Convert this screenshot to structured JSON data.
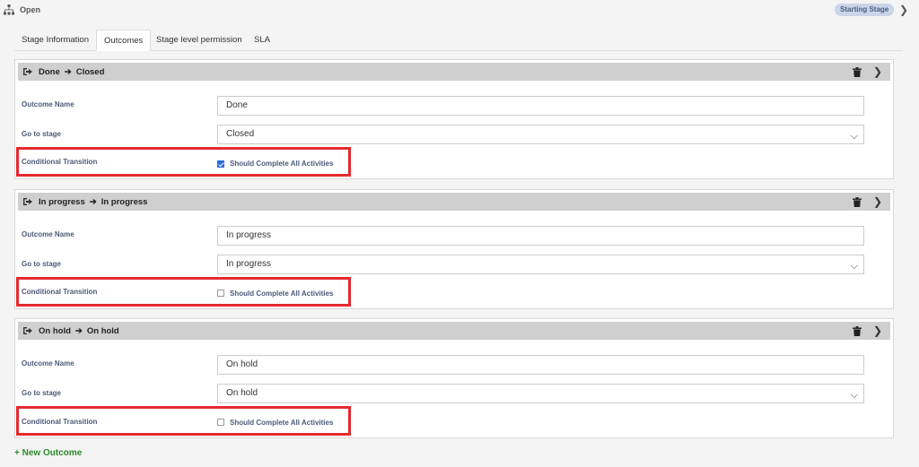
{
  "stage": {
    "name": "Open",
    "badge": "Starting Stage"
  },
  "tabs": [
    "Stage Information",
    "Outcomes",
    "Stage level permission",
    "SLA"
  ],
  "form_labels": {
    "outcome_name": "Outcome Name",
    "go_to_stage": "Go to stage",
    "conditional_transition": "Conditional Transition",
    "checkbox": "Should Complete All Activities"
  },
  "outcomes": [
    {
      "name": "Done",
      "target": "Closed",
      "name_value": "Done",
      "stage_value": "Closed",
      "checked": true
    },
    {
      "name": "In progress",
      "target": "In progress",
      "name_value": "In progress",
      "stage_value": "In progress",
      "checked": false
    },
    {
      "name": "On hold",
      "target": "On hold",
      "name_value": "On hold",
      "stage_value": "On hold",
      "checked": false
    }
  ],
  "new_outcome_label": "+ New Outcome",
  "icons": {
    "stage": "sitemap-icon",
    "outcome": "sign-out-icon",
    "arrow": "arrow-right-icon",
    "delete": "trash-icon",
    "expand": "chevron-right-icon",
    "select": "chevron-down-icon"
  },
  "colors": {
    "highlight": "#e52a2f",
    "badge_bg": "#c9d5ea",
    "header_bg": "#cfcfcf",
    "new_outcome": "#2c8a2c",
    "checkbox": "#2b6cd9"
  }
}
